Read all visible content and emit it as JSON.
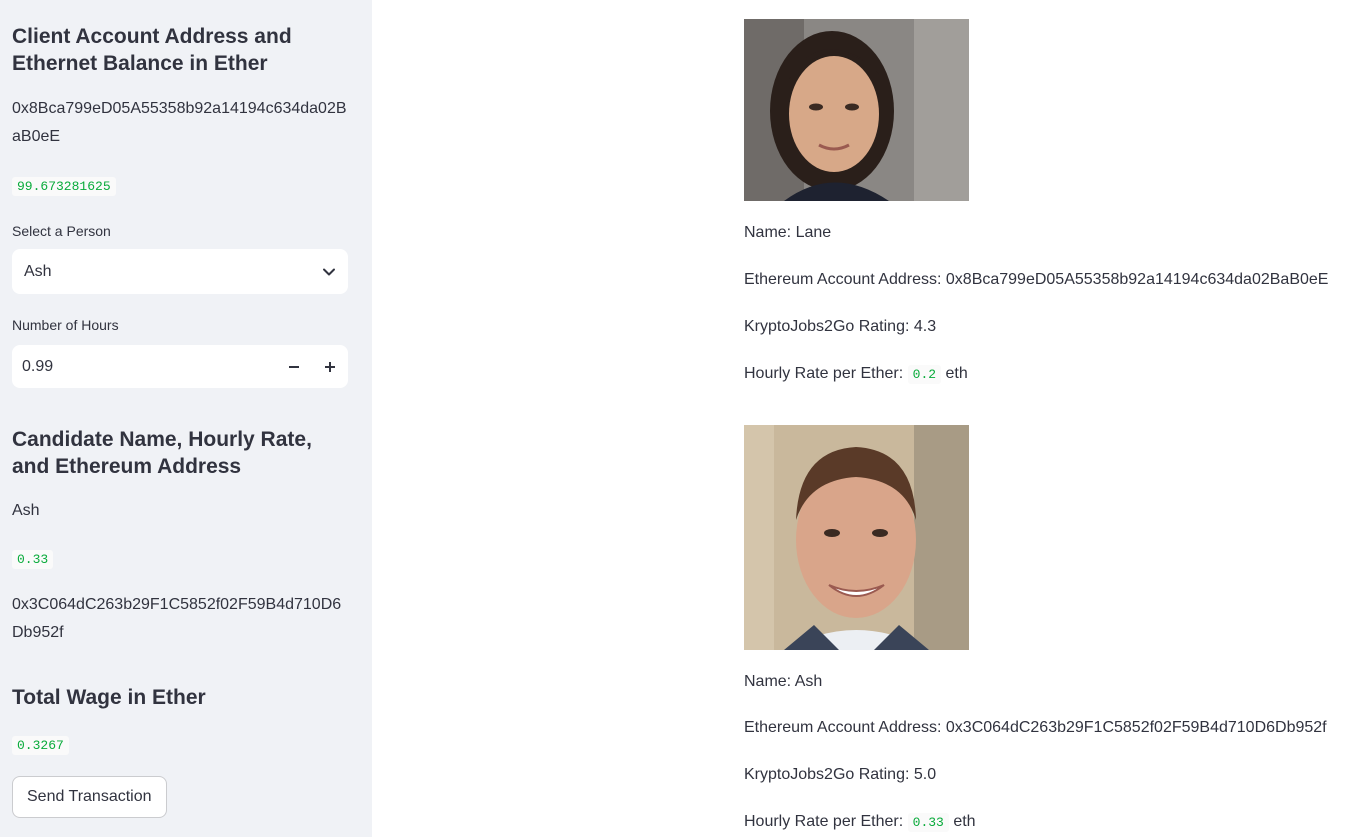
{
  "sidebar": {
    "client_heading": "Client Account Address and Ethernet Balance in Ether",
    "client_address": "0x8Bca799eD05A55358b92a14194c634da02BaB0eE",
    "client_balance": "99.673281625",
    "select_label": "Select a Person",
    "select_value": "Ash",
    "hours_label": "Number of Hours",
    "hours_value": "0.99",
    "candidate_heading": "Candidate Name, Hourly Rate, and Ethereum Address",
    "candidate_name": "Ash",
    "candidate_rate": "0.33",
    "candidate_address": "0x3C064dC263b29F1C5852f02F59B4d710D6Db952f",
    "total_wage_heading": "Total Wage in Ether",
    "total_wage": "0.3267",
    "send_button": "Send Transaction",
    "icons": {
      "select": "chevron-down-icon",
      "decrement": "minus-icon",
      "increment": "plus-icon"
    }
  },
  "candidates": [
    {
      "name_line": "Name: Lane",
      "address_line": "Ethereum Account Address: 0x8Bca799eD05A55358b92a14194c634da02BaB0eE",
      "rating_line": "KryptoJobs2Go Rating: 4.3",
      "rate_prefix": "Hourly Rate per Ether:",
      "rate_value": "0.2",
      "rate_suffix": "eth"
    },
    {
      "name_line": "Name: Ash",
      "address_line": "Ethereum Account Address: 0x3C064dC263b29F1C5852f02F59B4d710D6Db952f",
      "rating_line": "KryptoJobs2Go Rating: 5.0",
      "rate_prefix": "Hourly Rate per Ether:",
      "rate_value": "0.33",
      "rate_suffix": "eth"
    }
  ],
  "colors": {
    "sidebar_bg": "#f0f2f6",
    "code_green": "#09ab3b",
    "text": "#31333f"
  }
}
